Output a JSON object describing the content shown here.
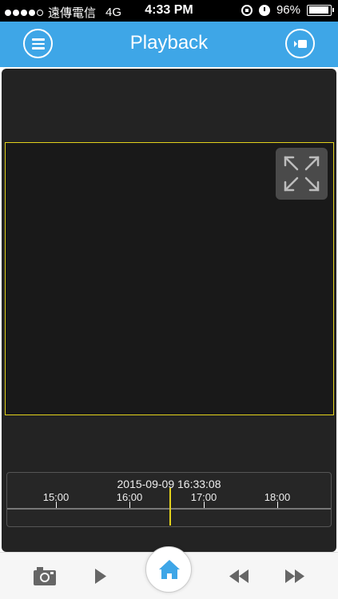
{
  "status_bar": {
    "carrier": "遠傳電信",
    "network": "4G",
    "time": "4:33 PM",
    "battery": "96%",
    "battery_level": 0.96,
    "signal_bars_filled": 4,
    "signal_bars_total": 5
  },
  "nav": {
    "title": "Playback",
    "menu_icon": "hamburger-menu-icon",
    "right_icon": "camera-video-icon"
  },
  "player": {
    "fullscreen_icon": "expand-arrows-icon",
    "frame_color": "#e3d21c"
  },
  "timeline": {
    "datetime": "2015-09-09 16:33:08",
    "hours": [
      "15:00",
      "16:00",
      "17:00",
      "18:00"
    ],
    "cursor_color": "#e3d21c"
  },
  "toolbar": {
    "items": [
      {
        "icon": "camera-snapshot-icon"
      },
      {
        "icon": "play-icon"
      },
      {
        "icon": "home-icon"
      },
      {
        "icon": "rewind-icon"
      },
      {
        "icon": "fast-forward-icon"
      }
    ],
    "accent": "#3ea6e7"
  },
  "colors": {
    "nav_bg": "#3ea6e7",
    "panel_bg": "#232323"
  }
}
